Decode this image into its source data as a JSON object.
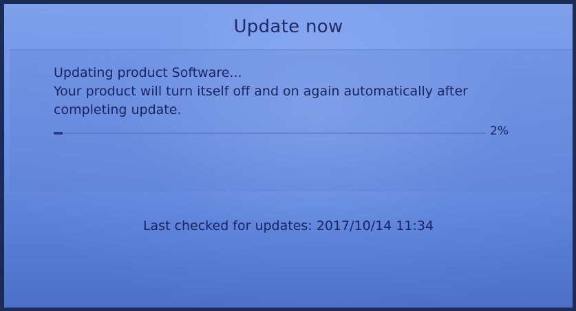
{
  "dialog": {
    "title": "Update now",
    "message_lines": [
      "Updating product Software...",
      "Your product will turn itself off and on again automatically after",
      "completing update."
    ],
    "progress": {
      "value": 0.02,
      "label": "2%"
    },
    "last_checked": "Last checked for updates: 2017/10/14 11:34"
  }
}
